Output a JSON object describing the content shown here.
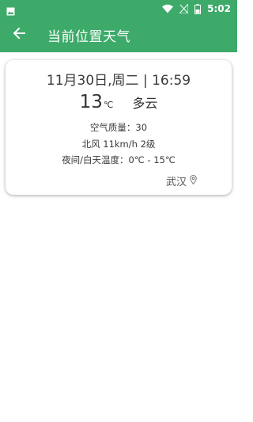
{
  "status_bar": {
    "time": "5:02",
    "battery_level": 0.4,
    "icons": [
      "image-icon",
      "wifi-icon",
      "signal-icon",
      "battery-icon"
    ]
  },
  "app_bar": {
    "title": "当前位置天气",
    "back_icon": "arrow-left-icon",
    "color": "#3daa6a"
  },
  "weather": {
    "datetime": "11月30日,周二 | 16:59",
    "temperature": "13",
    "temperature_unit": "℃",
    "condition": "多云",
    "air_quality": "空气质量：30",
    "wind": "北风 11km/h 2级",
    "temp_range": "夜间/白天温度：0℃ - 15℃",
    "location": "武汉",
    "location_icon": "map-pin-icon"
  }
}
